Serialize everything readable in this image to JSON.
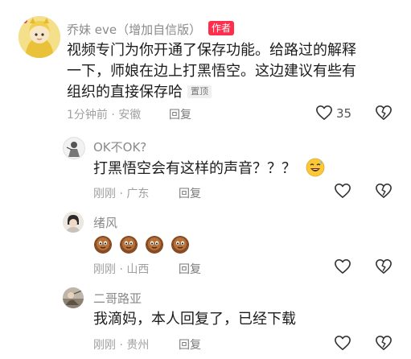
{
  "comments": [
    {
      "author": "乔妹 eve（增加自信版）",
      "author_badge": "作者",
      "text_lines": [
        "视频专门为你开通了保存功能。给路过的解释",
        "一下，师娘在边上打黑悟空。这边建议有些有",
        "组织的直接保存哈"
      ],
      "pinned_label": "置顶",
      "time_location": "1分钟前 · 安徽",
      "reply_label": "回复",
      "like_count": "35"
    },
    {
      "author": "OK不OK?",
      "text": "打黑悟空会有这样的声音？？？",
      "emoji": "😅",
      "time_location": "刚刚 · 广东",
      "reply_label": "回复"
    },
    {
      "author": "绪风",
      "emoji_count": 4,
      "time_location": "刚刚 · 山西",
      "reply_label": "回复"
    },
    {
      "author": "二哥路亚",
      "text": "我滴妈，本人回复了，已经下载",
      "time_location": "刚刚 · 贵州",
      "reply_label": "回复"
    }
  ],
  "colors": {
    "badge": "#ff2e4d",
    "meta": "#a0a0a0"
  }
}
